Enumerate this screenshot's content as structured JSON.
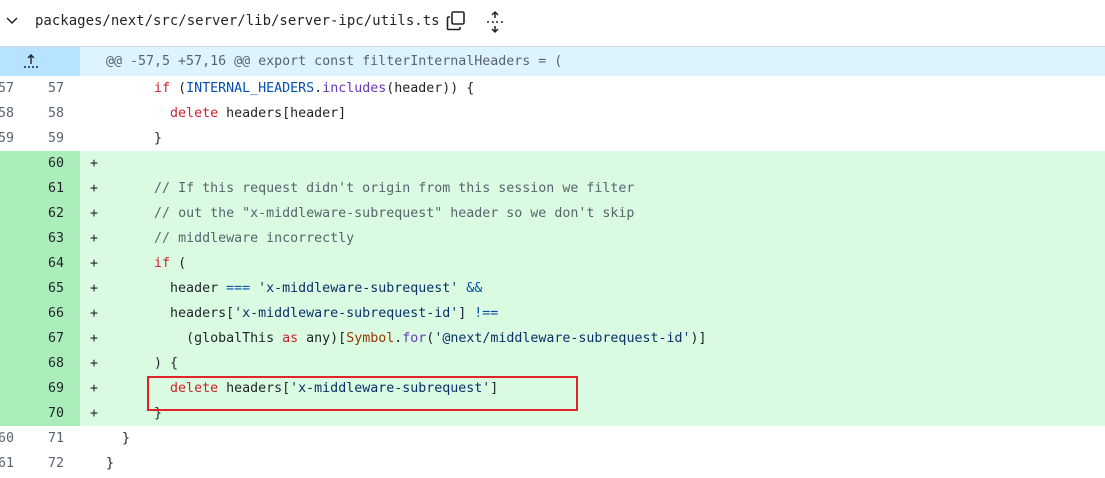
{
  "file": {
    "path": "packages/next/src/server/lib/server-ipc/utils.ts",
    "icons": [
      "chevron-down-icon",
      "copy-icon",
      "unfold-icon",
      "fold-up-icon"
    ]
  },
  "hunk_header": "@@ -57,5 +57,16 @@ export const filterInternalHeaders = (",
  "lines": [
    {
      "old": "57",
      "new": "57",
      "type": "ctx",
      "marker": ""
    },
    {
      "old": "58",
      "new": "58",
      "type": "ctx",
      "marker": ""
    },
    {
      "old": "59",
      "new": "59",
      "type": "ctx",
      "marker": ""
    },
    {
      "old": "",
      "new": "60",
      "type": "add",
      "marker": "+"
    },
    {
      "old": "",
      "new": "61",
      "type": "add",
      "marker": "+"
    },
    {
      "old": "",
      "new": "62",
      "type": "add",
      "marker": "+"
    },
    {
      "old": "",
      "new": "63",
      "type": "add",
      "marker": "+"
    },
    {
      "old": "",
      "new": "64",
      "type": "add",
      "marker": "+"
    },
    {
      "old": "",
      "new": "65",
      "type": "add",
      "marker": "+"
    },
    {
      "old": "",
      "new": "66",
      "type": "add",
      "marker": "+"
    },
    {
      "old": "",
      "new": "67",
      "type": "add",
      "marker": "+"
    },
    {
      "old": "",
      "new": "68",
      "type": "add",
      "marker": "+"
    },
    {
      "old": "",
      "new": "69",
      "type": "add",
      "marker": "+"
    },
    {
      "old": "",
      "new": "70",
      "type": "add",
      "marker": "+"
    },
    {
      "old": "60",
      "new": "71",
      "type": "ctx",
      "marker": ""
    },
    {
      "old": "61",
      "new": "72",
      "type": "ctx",
      "marker": ""
    }
  ],
  "code": {
    "l57": {
      "kw_if": "if",
      "p1": " (",
      "const": "INTERNAL_HEADERS",
      "dot": ".",
      "fn": "includes",
      "p2": "(header)) {"
    },
    "l58": {
      "kw": "delete",
      "rest": " headers[header]"
    },
    "l59": {
      "text": "}"
    },
    "l61": {
      "text": "// If this request didn't origin from this session we filter"
    },
    "l62": {
      "text": "// out the \"x-middleware-subrequest\" header so we don't skip"
    },
    "l63": {
      "text": "// middleware incorrectly"
    },
    "l64": {
      "kw": "if",
      "rest": " ("
    },
    "l65": {
      "a": "header ",
      "op": "===",
      "b": " ",
      "str": "'x-middleware-subrequest'",
      "c": " ",
      "op2": "&&"
    },
    "l66": {
      "a": "headers[",
      "str": "'x-middleware-subrequest-id'",
      "b": "] ",
      "op": "!=="
    },
    "l67": {
      "a": "(globalThis ",
      "kw": "as",
      "b": " any)[",
      "ty": "Symbol",
      "dot": ".",
      "fn": "for",
      "c": "(",
      "str": "'@next/middleware-subrequest-id'",
      "d": ")]"
    },
    "l68": {
      "text": ") {"
    },
    "l69": {
      "kw": "delete",
      "a": " headers[",
      "str": "'x-middleware-subrequest'",
      "b": "]"
    },
    "l70": {
      "text": "}"
    },
    "l71": {
      "text": "}"
    },
    "l72": {
      "text": "}"
    }
  },
  "colors": {
    "addition_bg": "#dafbe1",
    "addition_gutter": "#aceebb",
    "hunk_bg": "#ddf4ff",
    "highlight_box": "#e0242a"
  }
}
